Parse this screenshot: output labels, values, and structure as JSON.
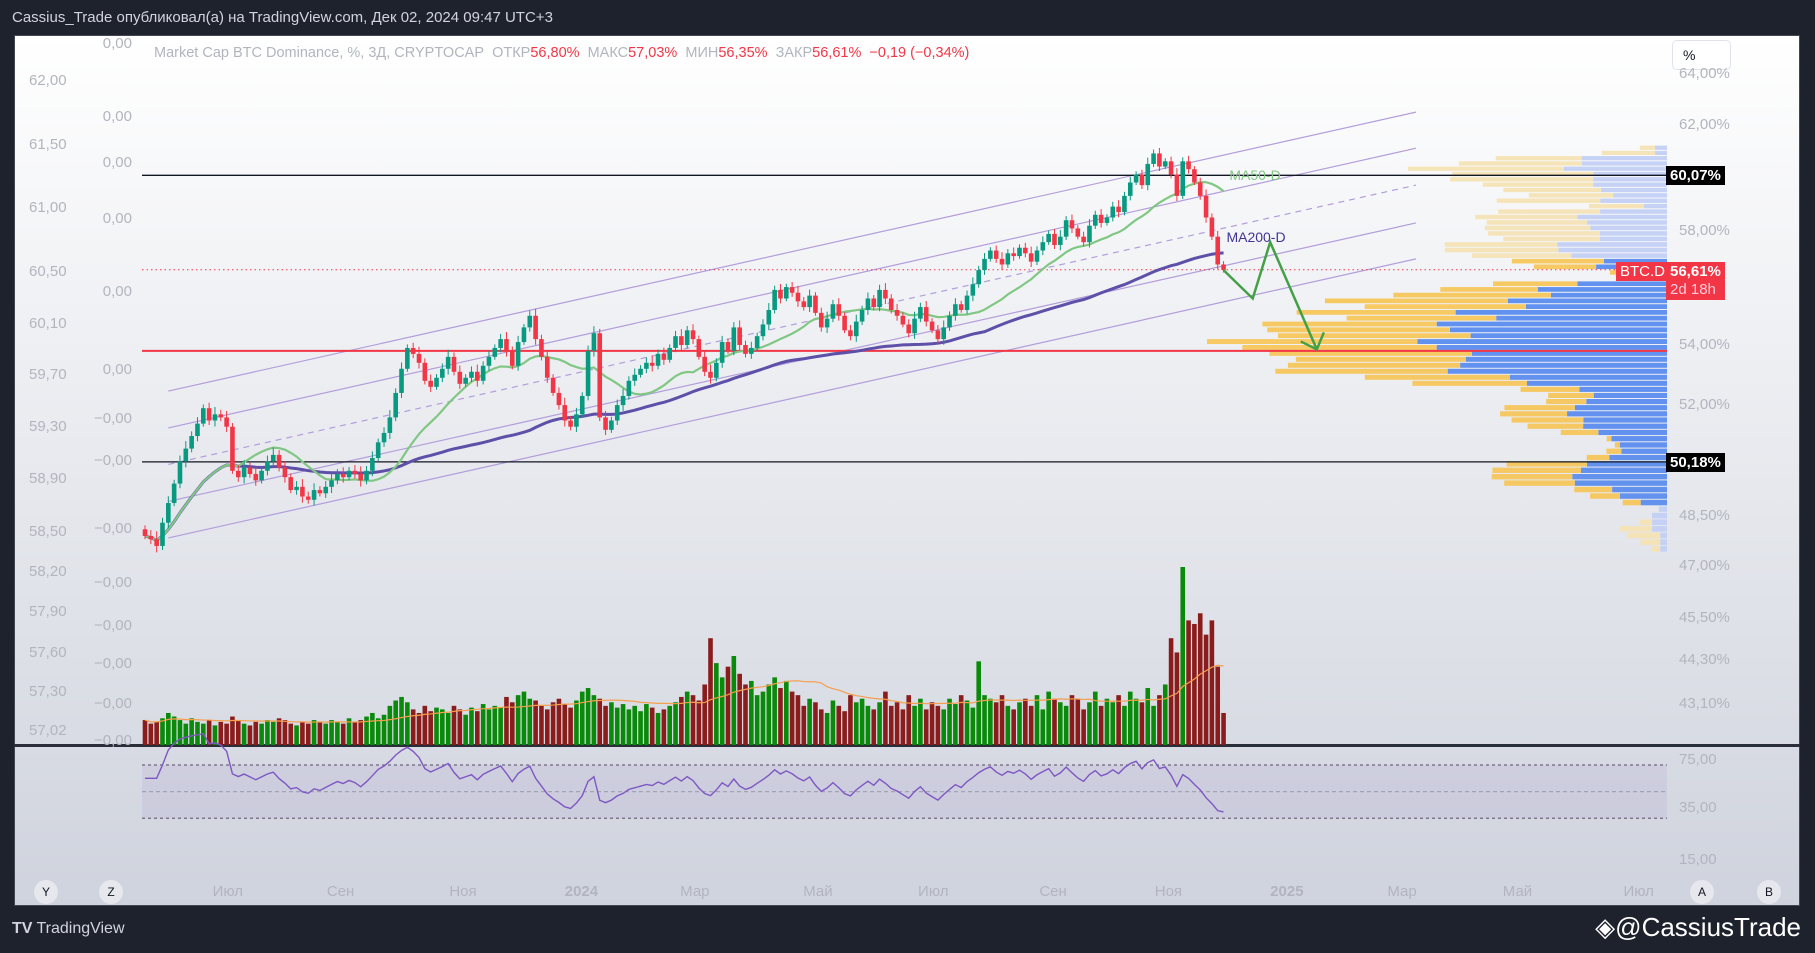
{
  "header": {
    "title": "Cassius_Trade опубликовал(а) на TradingView.com, Дек 02, 2024 09:47 UTC+3"
  },
  "legend": {
    "symbol": "Market Cap BTC Dominance, %, 3Д, CRYPTOCAP",
    "open_label": "ОТКР",
    "open": "56,80%",
    "high_label": "МАКС",
    "high": "57,03%",
    "low_label": "МИН",
    "low": "56,35%",
    "close_label": "ЗАКР",
    "close": "56,61%",
    "change": "−0,19 (−0,34%)"
  },
  "scale_button": "%",
  "price_tags": {
    "upper": "60,07%",
    "lower": "50,18%",
    "symbol": "BTC.D",
    "last": "56,61%",
    "countdown": "2d 18h"
  },
  "ma_labels": {
    "ma50": "MA50-D",
    "ma200": "MA200-D"
  },
  "left_scale_1": [
    "62,00",
    "61,50",
    "61,00",
    "60,50",
    "60,10",
    "59,70",
    "59,30",
    "58,90",
    "58,50",
    "58,20",
    "57,90",
    "57,60",
    "57,30",
    "57,02"
  ],
  "left_scale_2": [
    "0,00",
    "0,00",
    "0,00",
    "0,00",
    "0,00",
    "0,00",
    "−0,00",
    "−0,00",
    "−0,00",
    "−0,00",
    "−0,00",
    "−0,00",
    "−0,00",
    "−0,00"
  ],
  "footer": {
    "brand": "TradingView",
    "user": "@CassiusTrade"
  },
  "axis_buttons": [
    "Y",
    "Z",
    "A",
    "B"
  ],
  "colors": {
    "up": "#089981",
    "down": "#f23645",
    "vol_up": "#0a8a0a",
    "vol_down": "#8b1c1c",
    "ma50": "#81c784",
    "ma200": "#5e4fa8",
    "channel": "#b39ddb",
    "rsi": "#7e57c2",
    "vp_up": "#5b8def",
    "vp_down": "#f7c75c",
    "vp_up_light": "#c3d0f5",
    "vp_down_light": "#f6e3b6",
    "arrow": "#43a047",
    "hline_red": "#f23645"
  },
  "chart_data": {
    "type": "candlestick",
    "title": "Market Cap BTC Dominance, %, 3Д, CRYPTOCAP",
    "interval": "3D",
    "y_scale": "log",
    "y_ticks": [
      64,
      62,
      58,
      54,
      52,
      48.5,
      47,
      45.5,
      44.3,
      43.1
    ],
    "y_tick_labels": [
      "64,00%",
      "62,00%",
      "58,00%",
      "54,00%",
      "52,00%",
      "48,50%",
      "47,00%",
      "45,50%",
      "44,30%",
      "43,10%"
    ],
    "x_ticks": [
      {
        "label": "Июл",
        "i": 14
      },
      {
        "label": "Сен",
        "i": 33.6
      },
      {
        "label": "Ноя",
        "i": 54.6
      },
      {
        "label": "2024",
        "i": 74.4
      },
      {
        "label": "Мар",
        "i": 94.2
      },
      {
        "label": "Май",
        "i": 115.3
      },
      {
        "label": "Июл",
        "i": 135
      },
      {
        "label": "Сен",
        "i": 155.8
      },
      {
        "label": "Ноя",
        "i": 175.6
      },
      {
        "label": "2025",
        "i": 195.4
      },
      {
        "label": "Мар",
        "i": 215.5
      },
      {
        "label": "Май",
        "i": 235.3
      },
      {
        "label": "Июл",
        "i": 256
      }
    ],
    "first_open": 48.1,
    "closes": [
      47.9,
      47.8,
      47.6,
      48.3,
      48.9,
      49.5,
      50.2,
      50.6,
      51.0,
      51.4,
      51.9,
      51.5,
      51.7,
      51.6,
      51.3,
      49.9,
      49.7,
      50.0,
      49.8,
      49.6,
      49.9,
      50.2,
      50.4,
      50.0,
      49.7,
      49.3,
      49.4,
      49.1,
      49.0,
      49.3,
      49.2,
      49.4,
      49.6,
      49.8,
      49.7,
      49.9,
      49.8,
      49.6,
      49.9,
      50.3,
      50.8,
      51.1,
      51.6,
      52.4,
      53.2,
      53.9,
      53.7,
      53.4,
      52.8,
      52.6,
      52.9,
      53.2,
      53.6,
      53.1,
      52.7,
      52.9,
      53.1,
      52.8,
      53.3,
      53.6,
      53.9,
      54.2,
      53.8,
      53.3,
      54.1,
      54.6,
      55.0,
      54.2,
      53.6,
      52.9,
      52.4,
      52.0,
      51.5,
      51.3,
      51.7,
      52.3,
      53.8,
      54.4,
      51.6,
      51.2,
      51.5,
      52.0,
      52.3,
      52.8,
      53.0,
      53.2,
      53.4,
      53.3,
      53.7,
      53.5,
      53.9,
      54.3,
      54.0,
      54.5,
      54.2,
      53.6,
      53.1,
      52.9,
      53.4,
      54.1,
      53.8,
      54.6,
      54.0,
      53.7,
      53.9,
      54.3,
      54.7,
      55.2,
      55.9,
      55.6,
      56.0,
      55.8,
      55.5,
      55.3,
      55.7,
      55.1,
      54.6,
      54.9,
      55.4,
      55.0,
      54.5,
      54.3,
      54.8,
      55.2,
      55.6,
      55.3,
      55.9,
      55.6,
      55.2,
      55.0,
      54.7,
      54.4,
      54.9,
      55.3,
      54.8,
      54.5,
      54.2,
      54.6,
      55.0,
      55.4,
      55.2,
      55.7,
      56.1,
      56.6,
      57.0,
      57.3,
      57.0,
      56.8,
      57.2,
      57.1,
      57.4,
      57.2,
      56.9,
      57.3,
      57.6,
      57.9,
      57.5,
      57.8,
      58.4,
      58.1,
      57.8,
      57.6,
      58.2,
      58.6,
      58.3,
      58.5,
      58.9,
      58.7,
      59.3,
      59.8,
      60.1,
      59.7,
      60.5,
      60.9,
      60.4,
      60.6,
      60.1,
      59.3,
      60.6,
      60.3,
      59.8,
      59.3,
      58.5,
      57.8,
      56.8,
      56.61
    ],
    "volumes": [
      14,
      12,
      13,
      15,
      18,
      16,
      14,
      12,
      15,
      13,
      12,
      14,
      11,
      13,
      12,
      16,
      14,
      12,
      11,
      13,
      12,
      14,
      13,
      15,
      14,
      12,
      11,
      13,
      12,
      14,
      13,
      12,
      14,
      13,
      12,
      15,
      13,
      14,
      16,
      18,
      15,
      17,
      22,
      25,
      27,
      24,
      20,
      18,
      22,
      19,
      21,
      20,
      18,
      22,
      20,
      17,
      21,
      19,
      23,
      20,
      22,
      21,
      27,
      24,
      28,
      30,
      26,
      25,
      22,
      20,
      24,
      26,
      23,
      21,
      25,
      30,
      32,
      28,
      26,
      22,
      24,
      21,
      23,
      20,
      22,
      19,
      23,
      21,
      18,
      20,
      22,
      24,
      27,
      30,
      28,
      25,
      34,
      60,
      46,
      38,
      44,
      50,
      40,
      34,
      36,
      28,
      30,
      34,
      38,
      32,
      36,
      30,
      28,
      22,
      26,
      24,
      20,
      18,
      25,
      22,
      19,
      28,
      24,
      26,
      22,
      20,
      24,
      30,
      22,
      24,
      20,
      28,
      22,
      26,
      20,
      24,
      22,
      20,
      26,
      23,
      28,
      25,
      21,
      47,
      28,
      26,
      24,
      28,
      22,
      20,
      24,
      26,
      22,
      28,
      20,
      30,
      26,
      24,
      22,
      28,
      26,
      20,
      24,
      30,
      22,
      26,
      24,
      28,
      22,
      30,
      26,
      24,
      32,
      22,
      28,
      34,
      60,
      52,
      100,
      70,
      68,
      74,
      62,
      70,
      44,
      18
    ],
    "horizontal_lines": [
      {
        "price": 60.07,
        "color": "#131722"
      },
      {
        "price": 53.8,
        "color": "#f23645"
      },
      {
        "price": 50.18,
        "color": "#131722"
      }
    ],
    "channel": [
      {
        "i0": 4,
        "p0": 52.46,
        "i1": 218,
        "p1": 62.5
      },
      {
        "i0": 4,
        "p0": 51.26,
        "i1": 218,
        "p1": 61.1
      },
      {
        "i0": 4,
        "p0": 50.1,
        "i1": 218,
        "p1": 59.7,
        "dashed": true
      },
      {
        "i0": 4,
        "p0": 48.95,
        "i1": 218,
        "p1": 58.3
      },
      {
        "i0": 4,
        "p0": 47.84,
        "i1": 218,
        "p1": 57.0
      }
    ],
    "projection": [
      {
        "i": 185,
        "p": 56.6
      },
      {
        "i": 190,
        "p": 55.6
      },
      {
        "i": 193,
        "p": 57.6
      },
      {
        "i": 201,
        "p": 53.85
      }
    ],
    "rsi": {
      "period": 14,
      "levels": [
        70,
        50,
        30
      ],
      "tick_labels": [
        "75,00",
        "35,00",
        "15,00"
      ]
    },
    "ma_periods_candles": {
      "ma50": 17,
      "ma200": 67
    },
    "volume_ma_period": 20
  }
}
